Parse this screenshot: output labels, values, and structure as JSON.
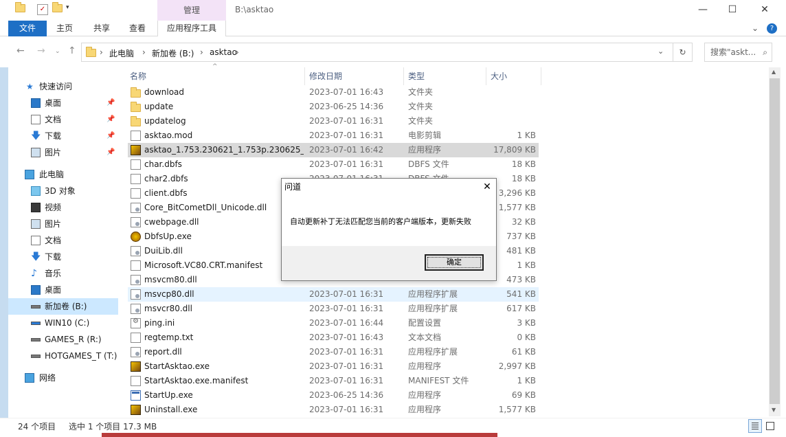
{
  "titlebar": {
    "manage_label": "管理",
    "path": "B:\\asktao",
    "minimize": "—",
    "maximize": "☐",
    "close": "✕"
  },
  "ribbon": {
    "tabs": [
      "文件",
      "主页",
      "共享",
      "查看",
      "应用程序工具"
    ]
  },
  "address": {
    "crumbs": [
      "此电脑",
      "新加卷 (B:)",
      "asktao"
    ],
    "search_placeholder": "搜索\"askt..."
  },
  "nav": {
    "quick_access": "快速访问",
    "items_quick": [
      "桌面",
      "文档",
      "下载",
      "图片"
    ],
    "this_pc": "此电脑",
    "items_pc": [
      "3D 对象",
      "视频",
      "图片",
      "文档",
      "下载",
      "音乐",
      "桌面",
      "新加卷 (B:)",
      "WIN10 (C:)",
      "GAMES_R (R:)",
      "HOTGAMES_T (T:)"
    ],
    "network": "网络"
  },
  "columns": {
    "name": "名称",
    "date": "修改日期",
    "type": "类型",
    "size": "大小"
  },
  "files": [
    {
      "name": "download",
      "date": "2023-07-01 16:43",
      "type": "文件夹",
      "size": "",
      "icon": "folder"
    },
    {
      "name": "update",
      "date": "2023-06-25 14:36",
      "type": "文件夹",
      "size": "",
      "icon": "folder"
    },
    {
      "name": "updatelog",
      "date": "2023-07-01 16:31",
      "type": "文件夹",
      "size": "",
      "icon": "folder"
    },
    {
      "name": "asktao.mod",
      "date": "2023-07-01 16:31",
      "type": "电影剪辑",
      "size": "1 KB",
      "icon": "doc"
    },
    {
      "name": "asktao_1.753.230621_1.753p.230625_...",
      "date": "2023-07-01 16:42",
      "type": "应用程序",
      "size": "17,809 KB",
      "icon": "app"
    },
    {
      "name": "char.dbfs",
      "date": "2023-07-01 16:31",
      "type": "DBFS 文件",
      "size": "18 KB",
      "icon": "doc"
    },
    {
      "name": "char2.dbfs",
      "date": "2023-07-01 16:31",
      "type": "DBFS 文件",
      "size": "18 KB",
      "icon": "doc"
    },
    {
      "name": "client.dbfs",
      "date": "",
      "type": "",
      "size": "3,296 KB",
      "icon": "doc"
    },
    {
      "name": "Core_BitCometDll_Unicode.dll",
      "date": "",
      "type": "",
      "size": "1,577 KB",
      "icon": "dll"
    },
    {
      "name": "cwebpage.dll",
      "date": "",
      "type": "",
      "size": "32 KB",
      "icon": "dll"
    },
    {
      "name": "DbfsUp.exe",
      "date": "",
      "type": "",
      "size": "737 KB",
      "icon": "circle-app"
    },
    {
      "name": "DuiLib.dll",
      "date": "",
      "type": "",
      "size": "481 KB",
      "icon": "dll"
    },
    {
      "name": "Microsoft.VC80.CRT.manifest",
      "date": "",
      "type": "",
      "size": "1 KB",
      "icon": "doc"
    },
    {
      "name": "msvcm80.dll",
      "date": "",
      "type": "",
      "size": "473 KB",
      "icon": "dll"
    },
    {
      "name": "msvcp80.dll",
      "date": "2023-07-01 16:31",
      "type": "应用程序扩展",
      "size": "541 KB",
      "icon": "dll"
    },
    {
      "name": "msvcr80.dll",
      "date": "2023-07-01 16:31",
      "type": "应用程序扩展",
      "size": "617 KB",
      "icon": "dll"
    },
    {
      "name": "ping.ini",
      "date": "2023-07-01 16:44",
      "type": "配置设置",
      "size": "3 KB",
      "icon": "gear"
    },
    {
      "name": "regtemp.txt",
      "date": "2023-07-01 16:43",
      "type": "文本文档",
      "size": "0 KB",
      "icon": "doc"
    },
    {
      "name": "report.dll",
      "date": "2023-07-01 16:31",
      "type": "应用程序扩展",
      "size": "61 KB",
      "icon": "dll"
    },
    {
      "name": "StartAsktao.exe",
      "date": "2023-07-01 16:31",
      "type": "应用程序",
      "size": "2,997 KB",
      "icon": "app"
    },
    {
      "name": "StartAsktao.exe.manifest",
      "date": "2023-07-01 16:31",
      "type": "MANIFEST 文件",
      "size": "1 KB",
      "icon": "doc"
    },
    {
      "name": "StartUp.exe",
      "date": "2023-06-25 14:36",
      "type": "应用程序",
      "size": "69 KB",
      "icon": "exe-blue"
    },
    {
      "name": "Uninstall.exe",
      "date": "2023-07-01 16:31",
      "type": "应用程序",
      "size": "1,577 KB",
      "icon": "app"
    }
  ],
  "status": {
    "count": "24 个项目",
    "selection": "选中 1 个项目  17.3 MB"
  },
  "dialog": {
    "title": "问道",
    "message": "自动更新补丁无法匹配您当前的客户端版本，更新失败",
    "ok": "确定"
  }
}
